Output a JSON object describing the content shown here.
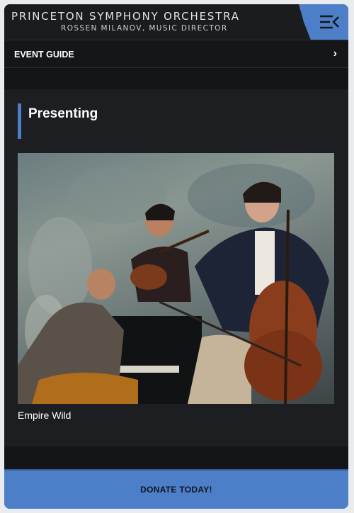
{
  "header": {
    "org_name": "PRINCETON SYMPHONY ORCHESTRA",
    "director_line": "ROSSEN MILANOV, MUSIC DIRECTOR",
    "menu_icon": "menu-collapse-icon",
    "accent_color": "#4d7fc9"
  },
  "event_guide": {
    "label": "EVENT GUIDE",
    "chevron": "›"
  },
  "section": {
    "title": "Presenting",
    "items": [
      {
        "image_icon": "ensemble-photo",
        "caption": "Empire Wild"
      }
    ]
  },
  "donate": {
    "label": "DONATE TODAY!"
  }
}
